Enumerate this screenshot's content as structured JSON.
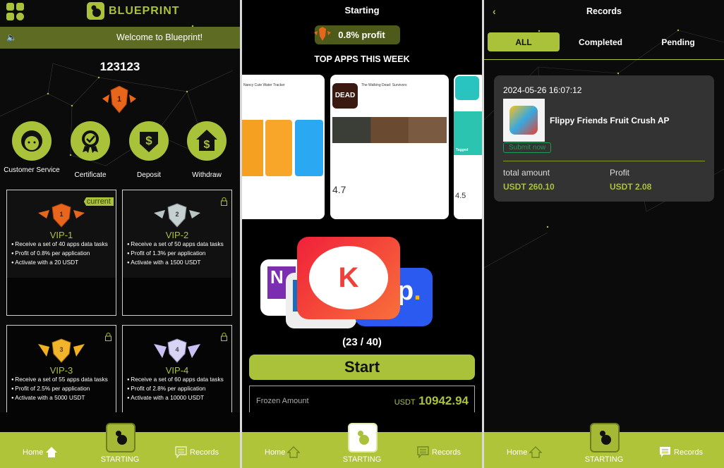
{
  "colors": {
    "accent": "#b0c43a",
    "banner": "#5e6b22",
    "card": "#333333",
    "submit": "#1e9a55"
  },
  "home": {
    "brand": "BLUEPRINT",
    "marquee": "Welcome to Blueprint!",
    "username": "123123",
    "actions": [
      {
        "label": "Customer Service",
        "icon": "customer-service-icon"
      },
      {
        "label": "Certificate",
        "icon": "certificate-icon"
      },
      {
        "label": "Deposit",
        "icon": "deposit-icon"
      },
      {
        "label": "Withdraw",
        "icon": "withdraw-icon"
      }
    ],
    "current_label": "current",
    "vips": [
      {
        "name": "VIP-1",
        "lines": [
          "Receive a set of 40 apps data tasks",
          "Profit of 0.8% per application",
          "Activate with a 20 USDT"
        ],
        "locked": false,
        "current": true
      },
      {
        "name": "VIP-2",
        "lines": [
          "Receive a set of 50 apps data tasks",
          "Profit of 1.3% per application",
          "Activate with a 1500 USDT"
        ],
        "locked": true
      },
      {
        "name": "VIP-3",
        "lines": [
          "Receive a set of 55 apps data tasks",
          "Profit of 2.5% per application",
          "Activate with a 5000 USDT"
        ],
        "locked": true
      },
      {
        "name": "VIP-4",
        "lines": [
          "Receive a set of 60 apps data tasks",
          "Profit of 2.8% per application",
          "Activate with a 10000 USDT"
        ],
        "locked": true
      }
    ]
  },
  "starting": {
    "title": "Starting",
    "profit": "0.8% profit",
    "section": "TOP APPS THIS WEEK",
    "shots": [
      {
        "title": "Nancy Cute Water Tracker"
      },
      {
        "title": "The Walking Dead: Survivors",
        "rating": "4.7"
      },
      {
        "title": "Tagged",
        "rating": "4.5"
      }
    ],
    "progress": "(23 / 40)",
    "start": "Start",
    "frozen_label": "Frozen Amount",
    "frozen_unit": "USDT",
    "frozen_value": "10942.94"
  },
  "records": {
    "title": "Records",
    "tabs": [
      "ALL",
      "Completed",
      "Pending"
    ],
    "active_tab": "ALL",
    "item": {
      "time": "2024-05-26 16:07:12",
      "app": "Flippy Friends Fruit Crush AP",
      "submit": "Submit now",
      "total_label": "total amount",
      "total": "USDT 260.10",
      "profit_label": "Profit",
      "profit": "USDT 2.08"
    }
  },
  "nav": {
    "home": "Home",
    "starting": "STARTING",
    "records": "Records"
  }
}
